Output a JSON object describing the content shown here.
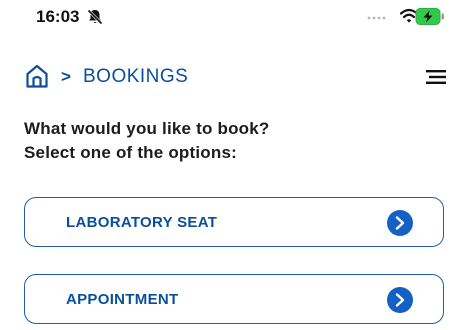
{
  "status_bar": {
    "time": "16:03",
    "icons": [
      "bell-slash-icon",
      "signal-dots-icon",
      "wifi-icon",
      "battery-charging-icon"
    ]
  },
  "header": {
    "home_icon": "home-icon",
    "separator": ">",
    "title": "BOOKINGS",
    "menu_icon": "hamburger-menu-icon"
  },
  "prompt": {
    "line1": "What would you like to book?",
    "line2": "Select one of the options:"
  },
  "options": [
    {
      "label": "LABORATORY SEAT",
      "icon": "chevron-right-circle-icon"
    },
    {
      "label": "APPOINTMENT",
      "icon": "chevron-right-circle-icon"
    }
  ],
  "colors": {
    "accent": "#0b4f9c",
    "button_fill": "#1560c4",
    "border": "#1f5fa8",
    "battery_fill": "#33c94a"
  }
}
